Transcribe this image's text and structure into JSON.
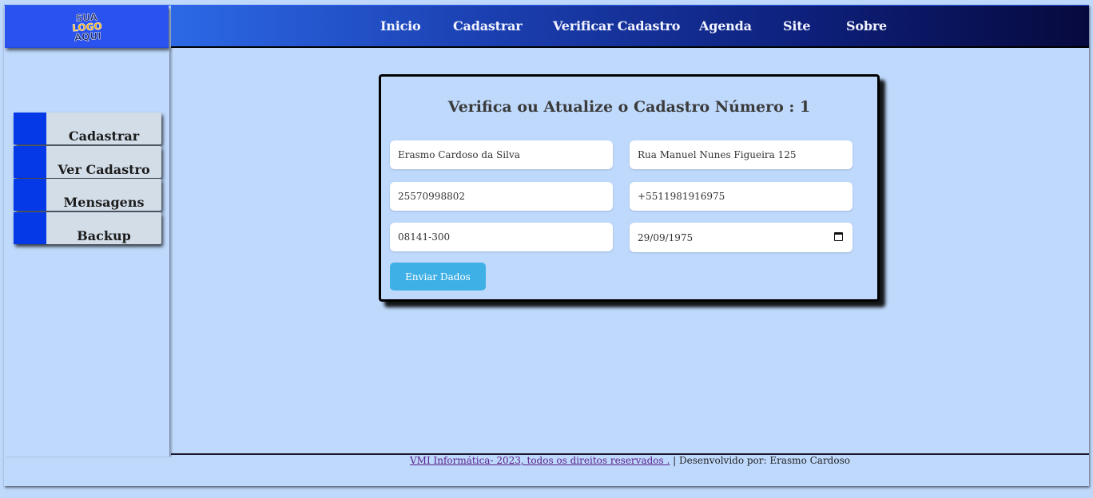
{
  "logo": {
    "line1": "SUA",
    "line2": "LOGO",
    "line3": "AQUI"
  },
  "nav": {
    "items": [
      {
        "label": "Inicio"
      },
      {
        "label": "Cadastrar"
      },
      {
        "label": "Verificar Cadastro"
      },
      {
        "label": "Agenda"
      },
      {
        "label": "Site"
      },
      {
        "label": "Sobre"
      }
    ]
  },
  "sidebar": {
    "items": [
      {
        "label": "Cadastrar"
      },
      {
        "label": "Ver Cadastro"
      },
      {
        "label": "Mensagens"
      },
      {
        "label": "Backup"
      }
    ]
  },
  "form": {
    "title": "Verifica ou Atualize o Cadastro Número : 1",
    "name": "Erasmo Cardoso da Silva",
    "address": "Rua Manuel Nunes Figueira 125",
    "document": "25570998802",
    "phone": "+5511981916975",
    "cep": "08141-300",
    "birthdate": "29/09/1975",
    "submit_label": "Enviar Dados"
  },
  "footer": {
    "link_text": "VMI Informática- 2023, todos os direitos reservados .",
    "separator": " | ",
    "developer_text": "Desenvolvido por: Erasmo Cardoso"
  },
  "colors": {
    "page_bg": "#bfd9fc",
    "accent_blue": "#0538e6",
    "button_blue": "#3fb0e6",
    "nav_gradient_start": "#2c69e6",
    "nav_gradient_end": "#07093d"
  }
}
